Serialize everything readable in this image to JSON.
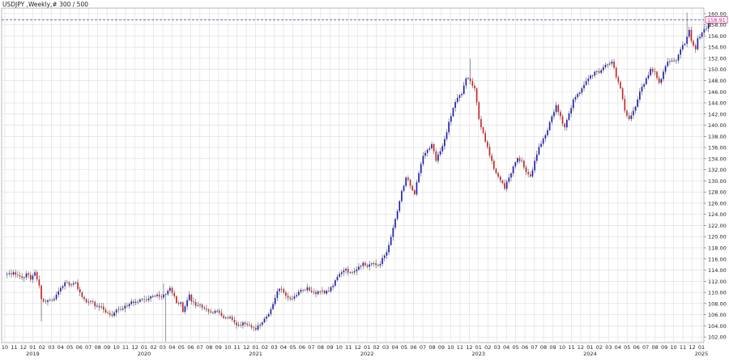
{
  "chart_data": {
    "type": "candlestick",
    "title": "USDJPY ,Weekly,# 300 / 500",
    "ylim": [
      101,
      161
    ],
    "y_ticks": [
      "102.00",
      "104.00",
      "106.00",
      "108.00",
      "110.00",
      "112.00",
      "114.00",
      "116.00",
      "118.00",
      "120.00",
      "122.00",
      "124.00",
      "126.00",
      "128.00",
      "130.00",
      "132.00",
      "134.00",
      "136.00",
      "138.00",
      "140.00",
      "142.00",
      "144.00",
      "146.00",
      "148.00",
      "150.00",
      "152.00",
      "154.00",
      "156.00",
      "158.00",
      "160.00"
    ],
    "current_price_label": "158.91",
    "current_price": 158.91,
    "x_month_labels": [
      "10",
      "11",
      "12",
      "01",
      "02",
      "03",
      "04",
      "05",
      "06",
      "07",
      "08",
      "09",
      "10",
      "11",
      "12",
      "01",
      "02",
      "03",
      "04",
      "05",
      "06",
      "07",
      "08",
      "09",
      "10",
      "11",
      "12",
      "01",
      "02",
      "03",
      "04",
      "05",
      "06",
      "07",
      "08",
      "09",
      "10",
      "11",
      "12",
      "01",
      "02",
      "03",
      "04",
      "05",
      "06",
      "07",
      "08",
      "09",
      "10",
      "11",
      "12",
      "01",
      "02",
      "03",
      "04",
      "05",
      "06",
      "07",
      "08",
      "09",
      "10",
      "11",
      "12",
      "01",
      "02",
      "03",
      "04",
      "05",
      "06",
      "07",
      "08",
      "09",
      "10",
      "11",
      "12",
      "01"
    ],
    "x_year_labels": [
      {
        "label": "2019",
        "month_index": 3
      },
      {
        "label": "2020",
        "month_index": 15
      },
      {
        "label": "2021",
        "month_index": 27
      },
      {
        "label": "2022",
        "month_index": 39
      },
      {
        "label": "2023",
        "month_index": 51
      },
      {
        "label": "2024",
        "month_index": 63
      },
      {
        "label": "2025",
        "month_index": 75
      }
    ],
    "weeks_per_month": 4.33,
    "anchors": [
      [
        0,
        113.2
      ],
      [
        4,
        113.6
      ],
      [
        8,
        112.6
      ],
      [
        10,
        113.4
      ],
      [
        12,
        112.3
      ],
      [
        14,
        113.6
      ],
      [
        16,
        111.2
      ],
      [
        17,
        108.8
      ],
      [
        19,
        108.3
      ],
      [
        22,
        108.6
      ],
      [
        24,
        109.6
      ],
      [
        26,
        110.8
      ],
      [
        28,
        111.8
      ],
      [
        31,
        111.4
      ],
      [
        33,
        111.8
      ],
      [
        34,
        110.6
      ],
      [
        37,
        108.8
      ],
      [
        39,
        108.3
      ],
      [
        43,
        107.6
      ],
      [
        46,
        106.9
      ],
      [
        48,
        106.3
      ],
      [
        50,
        105.8
      ],
      [
        52,
        106.9
      ],
      [
        54,
        106.9
      ],
      [
        56,
        107.6
      ],
      [
        58,
        107.9
      ],
      [
        61,
        108.3
      ],
      [
        63,
        108.7
      ],
      [
        67,
        108.9
      ],
      [
        69,
        109.3
      ],
      [
        71,
        109.6
      ],
      [
        73,
        109.1
      ],
      [
        74,
        109.6
      ],
      [
        76,
        110.3
      ],
      [
        77,
        110.8
      ],
      [
        78,
        109.9
      ],
      [
        80,
        108.1
      ],
      [
        82,
        108.2
      ],
      [
        83,
        106.5
      ],
      [
        84,
        107.5
      ],
      [
        85,
        108.6
      ],
      [
        86,
        109.6
      ],
      [
        87,
        108.4
      ],
      [
        89,
        107.6
      ],
      [
        91,
        107.8
      ],
      [
        93,
        107.1
      ],
      [
        95,
        106.6
      ],
      [
        97,
        106.3
      ],
      [
        99,
        106.7
      ],
      [
        101,
        105.8
      ],
      [
        103,
        105.5
      ],
      [
        105,
        105.6
      ],
      [
        107,
        104.6
      ],
      [
        109,
        104.2
      ],
      [
        111,
        104.6
      ],
      [
        113,
        104.2
      ],
      [
        115,
        103.7
      ],
      [
        117,
        103.3
      ],
      [
        119,
        104.2
      ],
      [
        121,
        105.3
      ],
      [
        123,
        106.1
      ],
      [
        125,
        107.9
      ],
      [
        127,
        110.2
      ],
      [
        129,
        110.6
      ],
      [
        131,
        109.4
      ],
      [
        133,
        108.8
      ],
      [
        135,
        109.3
      ],
      [
        137,
        110.1
      ],
      [
        139,
        110.4
      ],
      [
        141,
        110.9
      ],
      [
        143,
        110.1
      ],
      [
        145,
        109.7
      ],
      [
        147,
        110.2
      ],
      [
        149,
        109.8
      ],
      [
        151,
        110.2
      ],
      [
        153,
        111.2
      ],
      [
        155,
        112.8
      ],
      [
        157,
        113.6
      ],
      [
        159,
        114.2
      ],
      [
        161,
        113.6
      ],
      [
        163,
        113.8
      ],
      [
        165,
        114.6
      ],
      [
        167,
        115.3
      ],
      [
        169,
        114.6
      ],
      [
        171,
        115.2
      ],
      [
        173,
        114.9
      ],
      [
        175,
        115.1
      ],
      [
        177,
        116.6
      ],
      [
        179,
        118.5
      ],
      [
        181,
        121.6
      ],
      [
        183,
        124.6
      ],
      [
        185,
        128.2
      ],
      [
        187,
        130.6
      ],
      [
        189,
        129.1
      ],
      [
        191,
        127.6
      ],
      [
        193,
        131.4
      ],
      [
        195,
        134.5
      ],
      [
        197,
        135.6
      ],
      [
        199,
        136.6
      ],
      [
        201,
        133.6
      ],
      [
        203,
        135.3
      ],
      [
        205,
        137.5
      ],
      [
        207,
        140.6
      ],
      [
        209,
        143.1
      ],
      [
        211,
        144.9
      ],
      [
        213,
        145.6
      ],
      [
        215,
        148.4
      ],
      [
        217,
        147.9
      ],
      [
        219,
        146.6
      ],
      [
        221,
        141.1
      ],
      [
        223,
        138.6
      ],
      [
        225,
        136.1
      ],
      [
        227,
        133.6
      ],
      [
        229,
        131.4
      ],
      [
        231,
        130.1
      ],
      [
        233,
        128.6
      ],
      [
        235,
        130.6
      ],
      [
        237,
        132.6
      ],
      [
        239,
        134.1
      ],
      [
        241,
        133.6
      ],
      [
        243,
        131.6
      ],
      [
        245,
        130.8
      ],
      [
        247,
        133.6
      ],
      [
        249,
        136.1
      ],
      [
        251,
        137.6
      ],
      [
        253,
        139.1
      ],
      [
        255,
        141.6
      ],
      [
        257,
        143.6
      ],
      [
        259,
        141.6
      ],
      [
        261,
        139.6
      ],
      [
        263,
        142.1
      ],
      [
        265,
        144.6
      ],
      [
        267,
        145.6
      ],
      [
        269,
        146.6
      ],
      [
        271,
        147.9
      ],
      [
        273,
        148.9
      ],
      [
        275,
        149.6
      ],
      [
        277,
        149.4
      ],
      [
        279,
        150.4
      ],
      [
        281,
        150.9
      ],
      [
        283,
        151.4
      ],
      [
        285,
        148.6
      ],
      [
        287,
        146.6
      ],
      [
        289,
        142.6
      ],
      [
        291,
        141.1
      ],
      [
        293,
        142.6
      ],
      [
        295,
        144.6
      ],
      [
        297,
        146.9
      ],
      [
        299,
        148.4
      ],
      [
        301,
        150.1
      ],
      [
        303,
        149.6
      ],
      [
        305,
        147.6
      ],
      [
        307,
        149.6
      ],
      [
        309,
        151.4
      ],
      [
        311,
        151.6
      ],
      [
        313,
        151.6
      ],
      [
        315,
        153.6
      ],
      [
        317,
        154.6
      ],
      [
        319,
        157.1
      ],
      [
        320,
        155.1
      ],
      [
        322,
        153.6
      ],
      [
        323,
        155.6
      ],
      [
        325,
        156.6
      ],
      [
        327,
        157.3
      ],
      [
        329,
        158.91
      ]
    ],
    "notable_wicks": [
      {
        "week": 17,
        "low": 104.8
      },
      {
        "week": 74,
        "high": 111.6
      },
      {
        "week": 75,
        "low": 101.2
      },
      {
        "week": 217,
        "high": 151.9
      },
      {
        "week": 318,
        "high": 160.2
      }
    ],
    "current_price_line": true,
    "grid": true,
    "up_color": "#1a1ab5",
    "down_color": "#cc2222",
    "gridline_color": "#dcdcdc",
    "price_line_color": "#3a3acc",
    "price_label_color": "#cc2277"
  }
}
